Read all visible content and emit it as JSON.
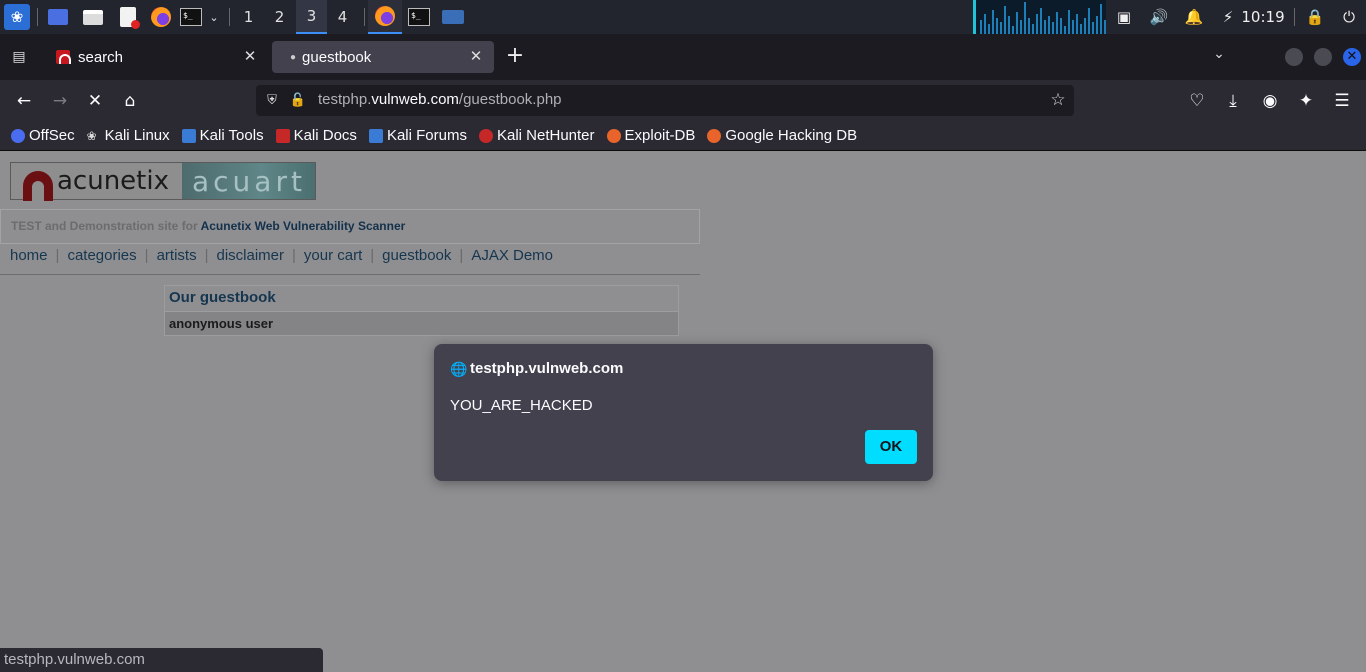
{
  "panel": {
    "workspaces": [
      "1",
      "2",
      "3",
      "4"
    ],
    "active_workspace": "3",
    "clock": "10:19"
  },
  "browser": {
    "tabs": [
      {
        "title": "search",
        "selected": false
      },
      {
        "title": "guestbook",
        "selected": true
      }
    ],
    "url": {
      "prefix": "testphp.",
      "host": "vulnweb.com",
      "path": "/guestbook.php"
    },
    "bookmarks": [
      {
        "label": "OffSec",
        "color": "#4a6cf0"
      },
      {
        "label": "Kali Linux",
        "color": "#cfcfcf"
      },
      {
        "label": "Kali Tools",
        "color": "#3a7bd5"
      },
      {
        "label": "Kali Docs",
        "color": "#c62828"
      },
      {
        "label": "Kali Forums",
        "color": "#3a7bd5"
      },
      {
        "label": "Kali NetHunter",
        "color": "#c62828"
      },
      {
        "label": "Exploit-DB",
        "color": "#e8642b"
      },
      {
        "label": "Google Hacking DB",
        "color": "#e8642b"
      }
    ],
    "status_text": "testphp.vulnweb.com"
  },
  "page": {
    "logo_left": "acunetix",
    "logo_right": "acuart",
    "test_prefix": "TEST and Demonstration site for ",
    "test_link": "Acunetix Web Vulnerability Scanner",
    "menu": [
      "home",
      "categories",
      "artists",
      "disclaimer",
      "your cart",
      "guestbook",
      "AJAX Demo"
    ],
    "guestbook_title": "Our guestbook",
    "guestbook_user": "anonymous user"
  },
  "dialog": {
    "origin": "testphp.vulnweb.com",
    "message": "YOU_ARE_HACKED",
    "ok_label": "OK",
    "accent": "#00ddff"
  }
}
